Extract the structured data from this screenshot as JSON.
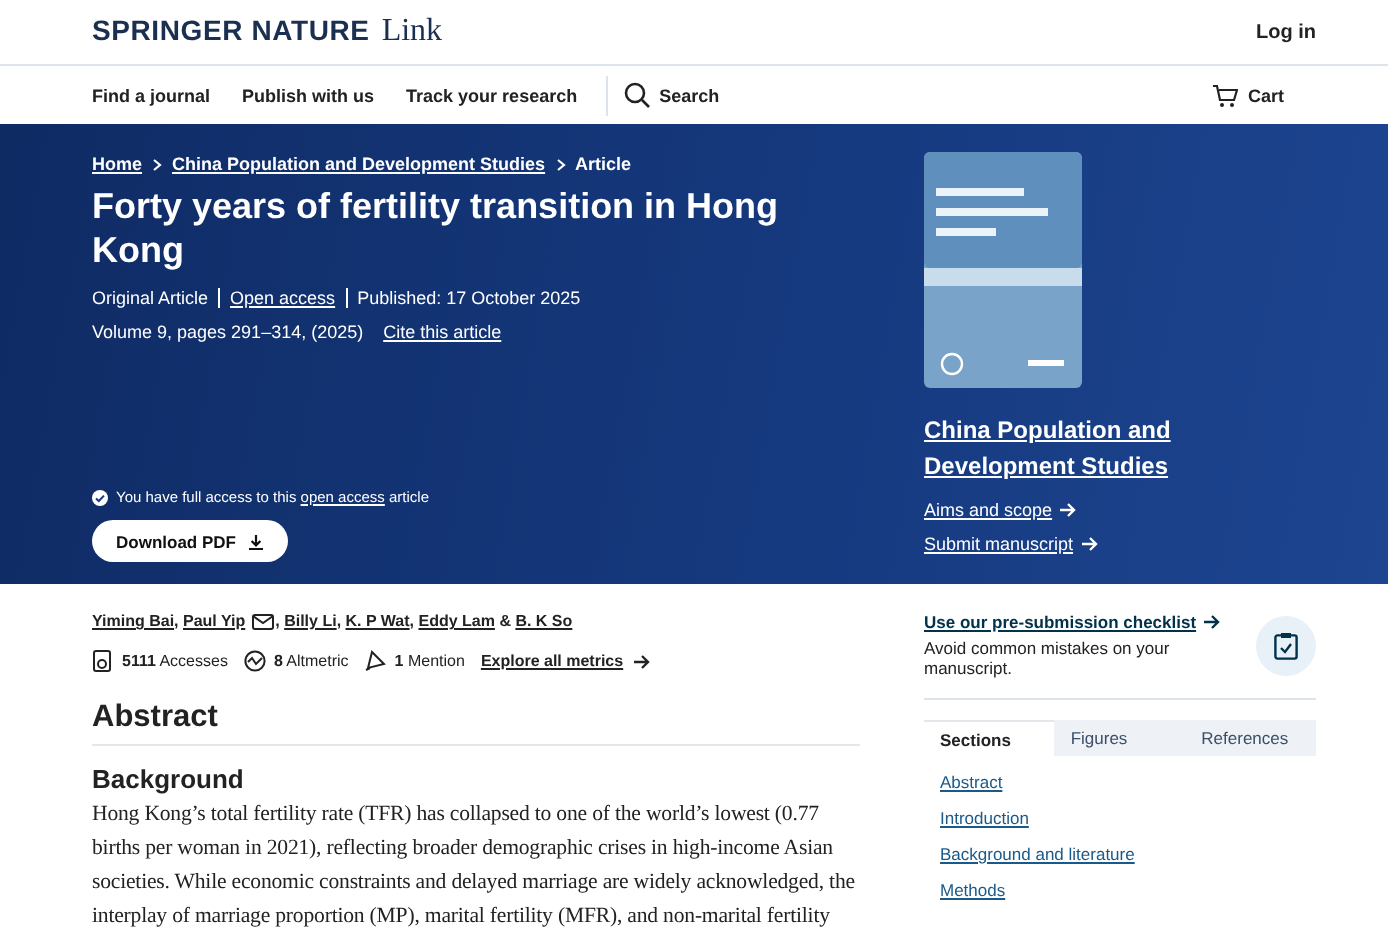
{
  "header": {
    "brand": "SPRINGER NATURE",
    "product": "Link",
    "login": "Log in"
  },
  "nav": {
    "items": [
      "Find a journal",
      "Publish with us",
      "Track your research"
    ],
    "search": "Search",
    "cart": "Cart"
  },
  "hero": {
    "breadcrumbs": [
      {
        "label": "Home",
        "link": true
      },
      {
        "label": "China Population and Development Studies",
        "link": true
      },
      {
        "label": "Article",
        "link": false
      }
    ],
    "title": "Forty years of fertility transition in Hong Kong",
    "meta": [
      {
        "label": "Original Article",
        "link": false
      },
      {
        "label": "Open access",
        "link": true
      },
      {
        "label": "Published: 17 October 2025",
        "link": false
      }
    ],
    "citation": "Volume 9, pages 291–314, (2025)",
    "cite_link": "Cite this article",
    "access": {
      "before": "You have full access to this ",
      "link": "open access",
      "after": " article"
    },
    "download": "Download PDF",
    "journal": {
      "title": "China Population and Development Studies",
      "links": [
        "Aims and scope",
        "Submit manuscript"
      ]
    }
  },
  "authors": [
    {
      "name": "Yiming Bai",
      "mail": false,
      "sep": ", "
    },
    {
      "name": "Paul Yip",
      "mail": true,
      "sep": ", "
    },
    {
      "name": "Billy Li",
      "mail": false,
      "sep": ", "
    },
    {
      "name": "K. P Wat",
      "mail": false,
      "sep": ", "
    },
    {
      "name": "Eddy Lam",
      "mail": false,
      "sep": " & "
    },
    {
      "name": "B. K So",
      "mail": false
    }
  ],
  "metrics": [
    {
      "kind": "accesses",
      "text": "**5111** Accesses"
    },
    {
      "kind": "altmetric",
      "text": "**8** Altmetric"
    },
    {
      "kind": "mention",
      "text": "**1** Mention"
    }
  ],
  "metrics_link": "Explore all metrics",
  "abstract": {
    "heading": "Abstract",
    "subheading": "Background",
    "text": "Hong Kong’s total fertility rate (TFR) has collapsed to one of the world’s lowest (0.77 births per woman in 2021), reflecting broader demographic crises in high-income Asian societies. While economic constraints and delayed marriage are widely acknowledged, the interplay of marriage proportion (MP), marital fertility (MFR), and non-marital fertility"
  },
  "aside": {
    "checklist_link": "Use our pre-submission checklist",
    "checklist_text": "Avoid common mistakes on your manuscript.",
    "tabs": [
      {
        "label": "Sections",
        "selected": true
      },
      {
        "label": "Figures",
        "selected": false
      },
      {
        "label": "References",
        "selected": false
      }
    ],
    "sections": [
      "Abstract",
      "Introduction",
      "Background and literature",
      "Methods"
    ]
  }
}
